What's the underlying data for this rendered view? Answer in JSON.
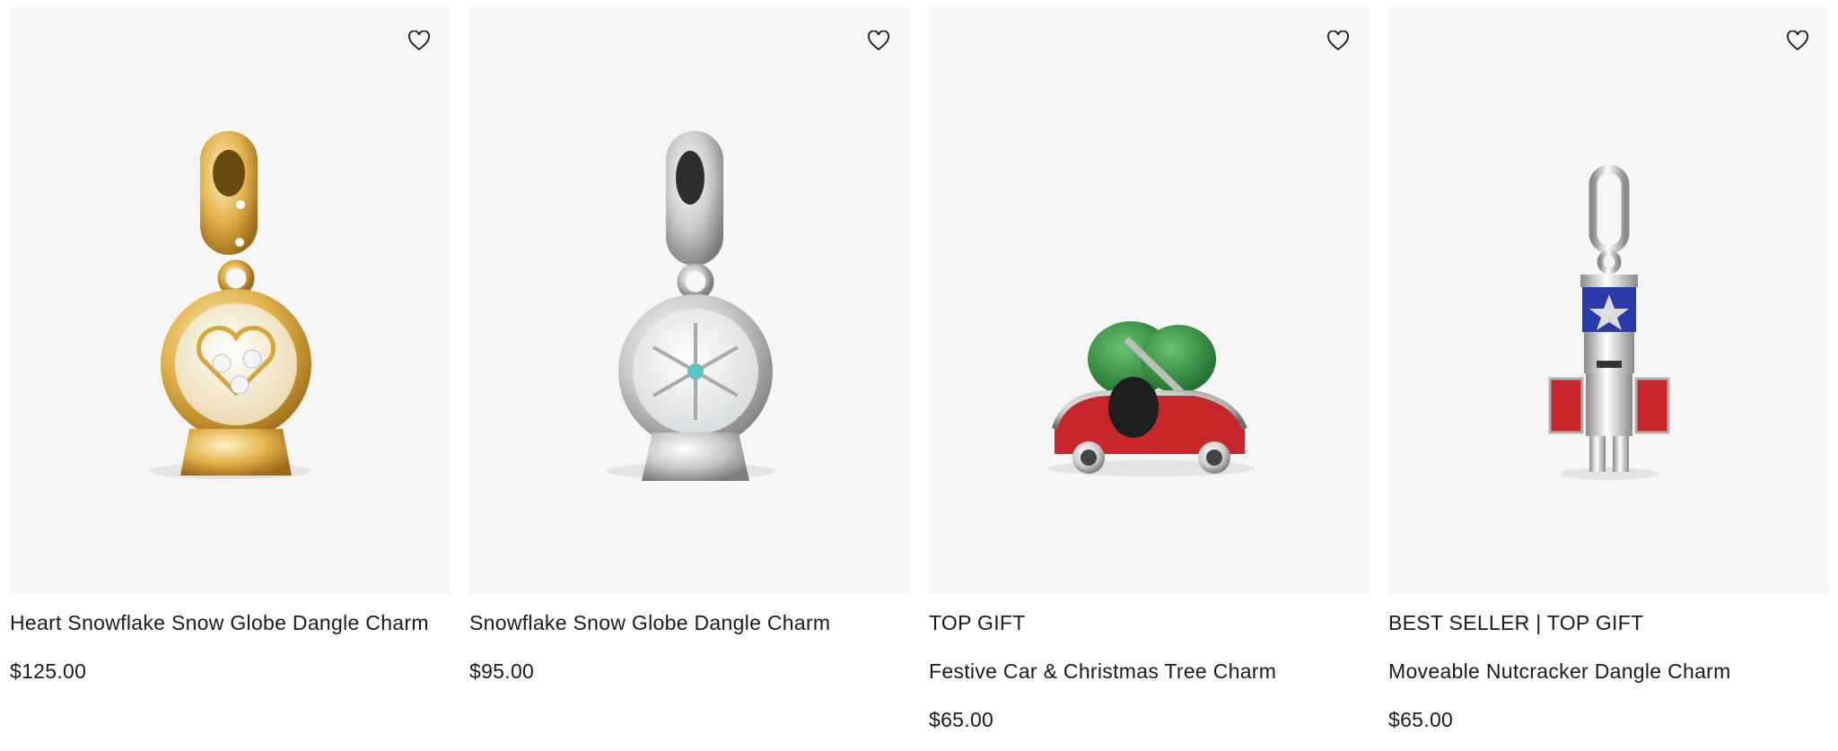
{
  "products": [
    {
      "badge": "",
      "name": "Heart Snowflake Snow Globe Dangle Charm",
      "price": "$125.00",
      "wishlist_icon": "heart-outline-icon"
    },
    {
      "badge": "",
      "name": "Snowflake Snow Globe Dangle Charm",
      "price": "$95.00",
      "wishlist_icon": "heart-outline-icon"
    },
    {
      "badge": "TOP GIFT",
      "name": "Festive Car & Christmas Tree Charm",
      "price": "$65.00",
      "wishlist_icon": "heart-outline-icon"
    },
    {
      "badge": "BEST SELLER | TOP GIFT",
      "name": "Moveable Nutcracker Dangle Charm",
      "price": "$65.00",
      "wishlist_icon": "heart-outline-icon"
    }
  ],
  "colors": {
    "image_bg": "#f6f6f6",
    "text": "#1a1a1a",
    "gold": "#e2b24a",
    "silver": "#c9c9c9",
    "red_enamel": "#c8262b",
    "green_enamel": "#2b8a3a",
    "blue_enamel": "#2a3aa8"
  }
}
